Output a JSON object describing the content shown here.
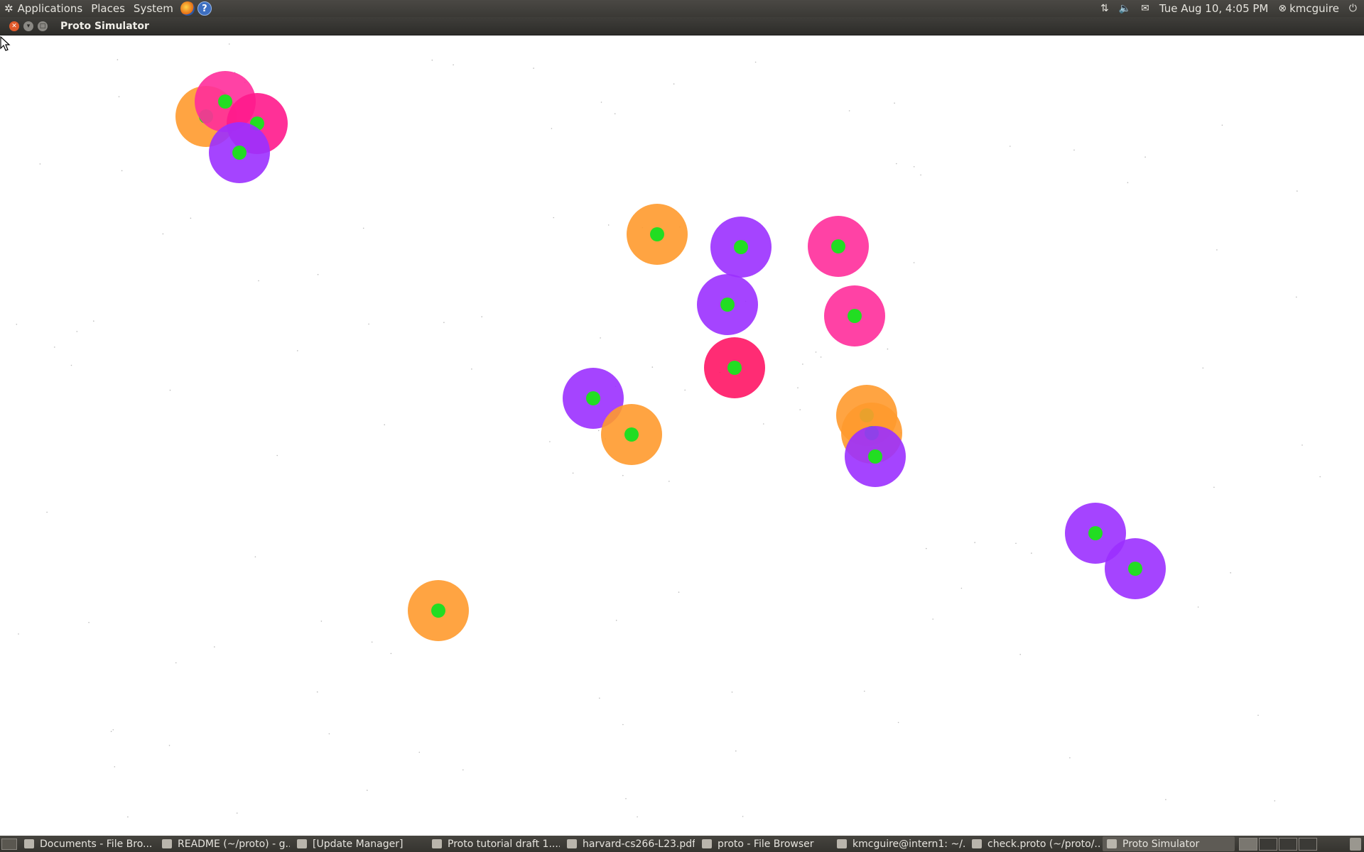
{
  "top_panel": {
    "menus": [
      "Applications",
      "Places",
      "System"
    ],
    "datetime": "Tue Aug 10,  4:05 PM",
    "user": "kmcguire",
    "icons": [
      "ubuntu-logo-icon",
      "firefox-icon",
      "help-icon",
      "network-icon",
      "volume-icon",
      "mail-icon",
      "user-status-icon",
      "power-icon"
    ]
  },
  "window": {
    "title": "Proto Simulator"
  },
  "simulation": {
    "colors": {
      "orange": "#ff9a2e",
      "purple": "#9b30ff",
      "magenta": "#ff2d9b",
      "hot_pink": "#ff1a8c",
      "red": "#ff1565",
      "center_dot": "#22dd22"
    },
    "devices": [
      {
        "color": "orange"
      },
      {
        "color": "magenta"
      },
      {
        "color": "hot_pink"
      },
      {
        "color": "purple"
      },
      {
        "color": "orange"
      },
      {
        "color": "purple"
      },
      {
        "color": "magenta"
      },
      {
        "color": "purple"
      },
      {
        "color": "magenta"
      },
      {
        "color": "red"
      },
      {
        "color": "purple"
      },
      {
        "color": "orange"
      },
      {
        "color": "orange"
      },
      {
        "color": "orange"
      },
      {
        "color": "purple"
      },
      {
        "color": "purple"
      },
      {
        "color": "purple"
      },
      {
        "color": "orange"
      }
    ]
  },
  "taskbar": {
    "tasks": [
      {
        "label": "Documents - File Bro..."
      },
      {
        "label": "README (~/proto) - g..."
      },
      {
        "label": "[Update Manager]"
      },
      {
        "label": "Proto tutorial draft 1...."
      },
      {
        "label": "harvard-cs266-L23.pdf"
      },
      {
        "label": "proto - File Browser"
      },
      {
        "label": "kmcguire@intern1: ~/..."
      },
      {
        "label": "check.proto (~/proto/..."
      },
      {
        "label": "Proto Simulator"
      }
    ],
    "active_task": "Proto Simulator"
  }
}
